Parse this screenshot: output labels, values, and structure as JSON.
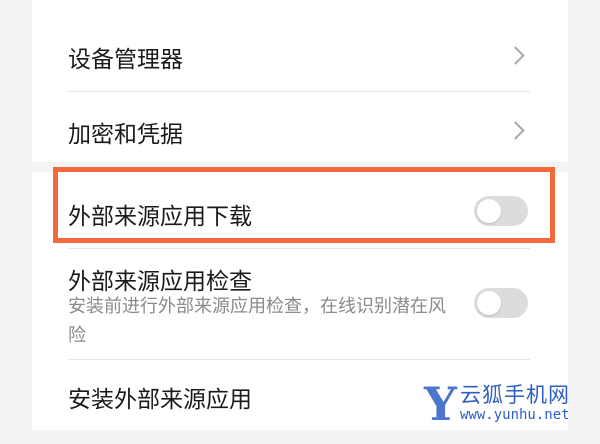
{
  "settings": {
    "items": [
      {
        "label": "设备管理器"
      },
      {
        "label": "加密和凭据"
      },
      {
        "label": "外部来源应用下载",
        "toggle_on": false
      },
      {
        "label": "外部来源应用检查",
        "description": "安装前进行外部来源应用检查，在线识别潜在风险",
        "toggle_on": false
      },
      {
        "label": "安装外部来源应用"
      }
    ]
  },
  "highlight": {
    "color": "#f26a3a"
  },
  "watermark": {
    "letter": "Y",
    "name": "云狐手机网",
    "url": "www.yunhu.net"
  }
}
